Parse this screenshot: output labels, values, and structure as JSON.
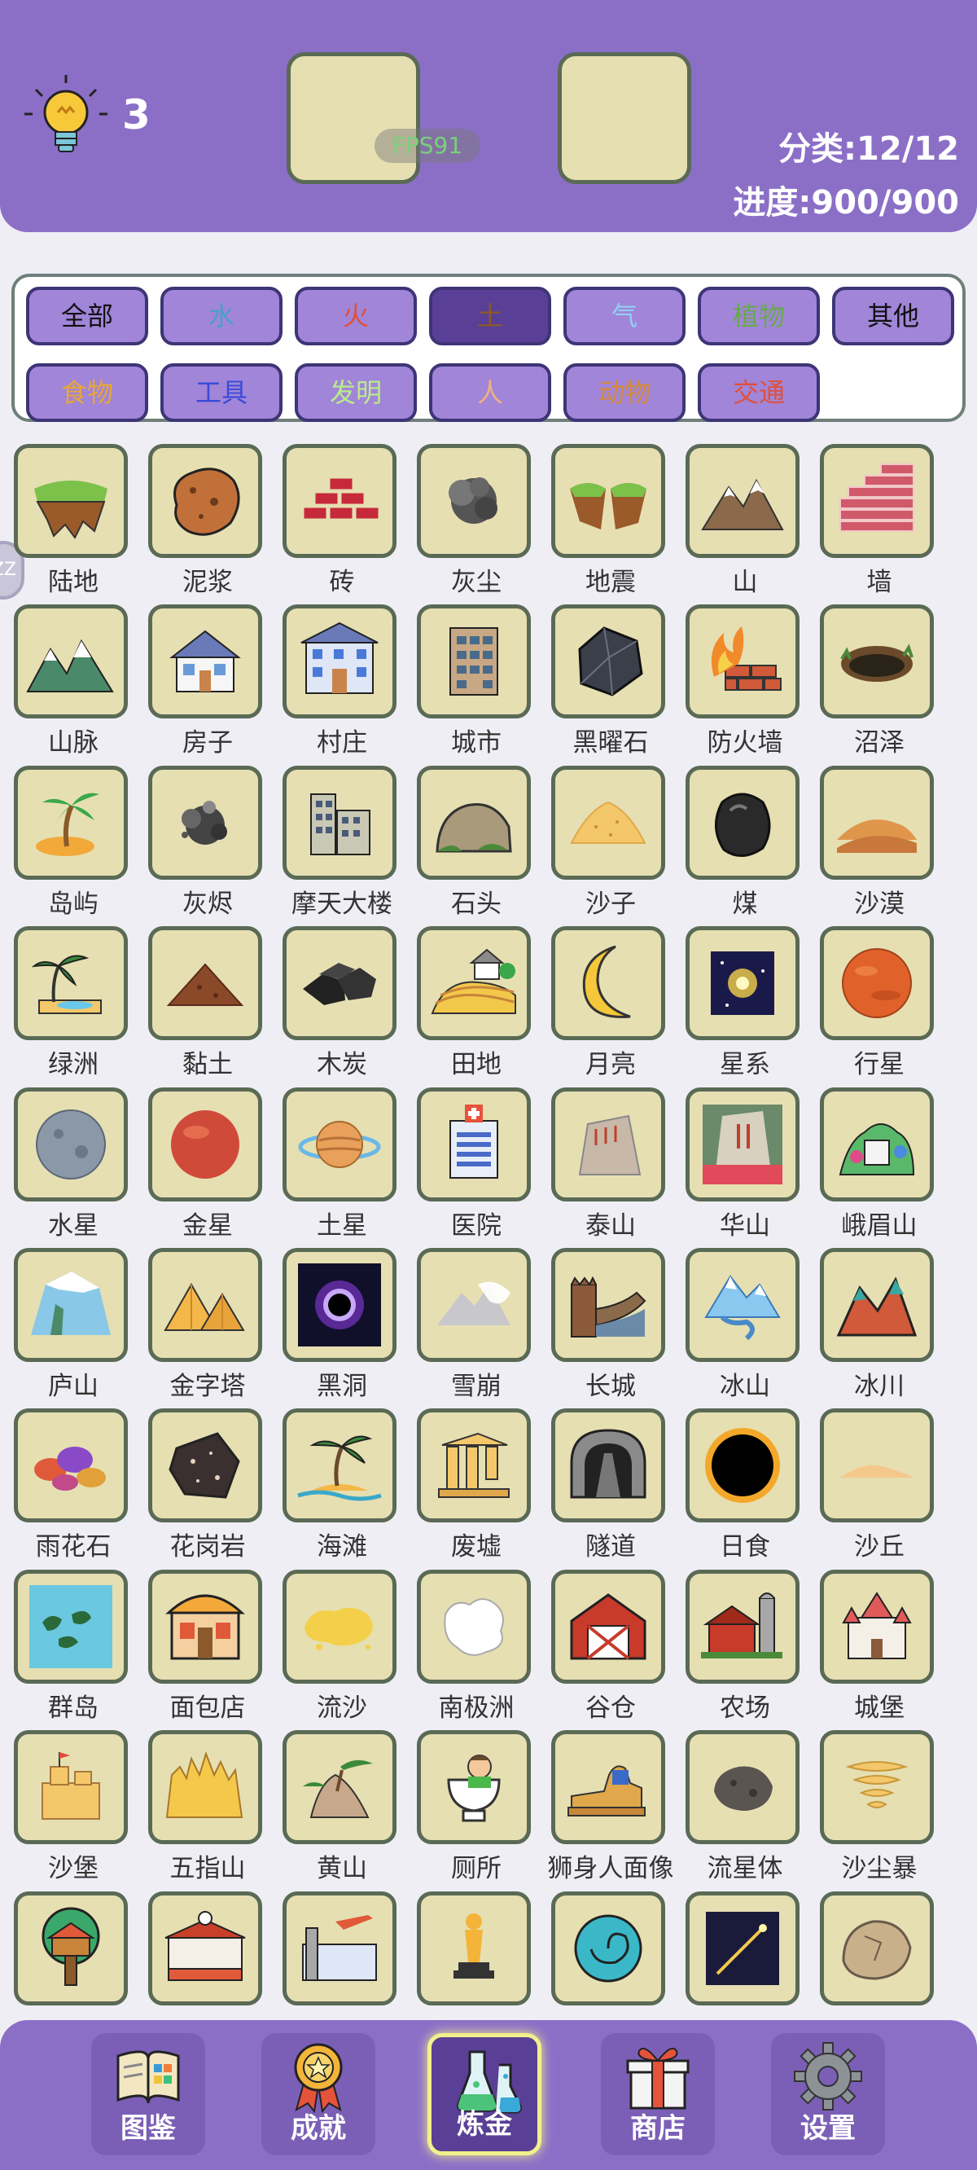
{
  "header": {
    "hint_count": "3",
    "fps": "FPS91",
    "category_stat": "分类:12/12",
    "progress_stat": "进度:900/900"
  },
  "categories": [
    {
      "label": "全部",
      "color": "#111111"
    },
    {
      "label": "水",
      "color": "#4aa0c8"
    },
    {
      "label": "火",
      "color": "#e0503a"
    },
    {
      "label": "土",
      "color": "#8a5a2a"
    },
    {
      "label": "气",
      "color": "#8fd0f0"
    },
    {
      "label": "植物",
      "color": "#6aa84f"
    },
    {
      "label": "其他",
      "color": "#111111"
    },
    {
      "label": "食物",
      "color": "#e8a63a"
    },
    {
      "label": "工具",
      "color": "#3a4ad8"
    },
    {
      "label": "发明",
      "color": "#b8ec8a"
    },
    {
      "label": "人",
      "color": "#f0b080"
    },
    {
      "label": "动物",
      "color": "#d68a3a"
    },
    {
      "label": "交通",
      "color": "#e0503a"
    }
  ],
  "active_category": "土",
  "elements": [
    {
      "label": "陆地",
      "icon": "land-icon"
    },
    {
      "label": "泥浆",
      "icon": "mud-icon"
    },
    {
      "label": "砖",
      "icon": "brick-icon"
    },
    {
      "label": "灰尘",
      "icon": "dust-icon"
    },
    {
      "label": "地震",
      "icon": "earthquake-icon"
    },
    {
      "label": "山",
      "icon": "mountain-icon"
    },
    {
      "label": "墙",
      "icon": "wall-icon"
    },
    {
      "label": "山脉",
      "icon": "mountain-range-icon"
    },
    {
      "label": "房子",
      "icon": "house-icon"
    },
    {
      "label": "村庄",
      "icon": "village-icon"
    },
    {
      "label": "城市",
      "icon": "city-icon"
    },
    {
      "label": "黑曜石",
      "icon": "obsidian-icon"
    },
    {
      "label": "防火墙",
      "icon": "firewall-icon"
    },
    {
      "label": "沼泽",
      "icon": "swamp-icon"
    },
    {
      "label": "岛屿",
      "icon": "island-icon"
    },
    {
      "label": "灰烬",
      "icon": "ash-icon"
    },
    {
      "label": "摩天大楼",
      "icon": "skyscraper-icon"
    },
    {
      "label": "石头",
      "icon": "stone-icon"
    },
    {
      "label": "沙子",
      "icon": "sand-icon"
    },
    {
      "label": "煤",
      "icon": "coal-icon"
    },
    {
      "label": "沙漠",
      "icon": "desert-icon"
    },
    {
      "label": "绿洲",
      "icon": "oasis-icon"
    },
    {
      "label": "黏土",
      "icon": "clay-icon"
    },
    {
      "label": "木炭",
      "icon": "charcoal-icon"
    },
    {
      "label": "田地",
      "icon": "field-icon"
    },
    {
      "label": "月亮",
      "icon": "moon-icon"
    },
    {
      "label": "星系",
      "icon": "galaxy-icon"
    },
    {
      "label": "行星",
      "icon": "planet-icon"
    },
    {
      "label": "水星",
      "icon": "mercury-icon"
    },
    {
      "label": "金星",
      "icon": "venus-icon"
    },
    {
      "label": "土星",
      "icon": "saturn-icon"
    },
    {
      "label": "医院",
      "icon": "hospital-icon"
    },
    {
      "label": "泰山",
      "icon": "mount-tai-icon"
    },
    {
      "label": "华山",
      "icon": "mount-hua-icon"
    },
    {
      "label": "峨眉山",
      "icon": "mount-emei-icon"
    },
    {
      "label": "庐山",
      "icon": "mount-lu-icon"
    },
    {
      "label": "金字塔",
      "icon": "pyramid-icon"
    },
    {
      "label": "黑洞",
      "icon": "black-hole-icon"
    },
    {
      "label": "雪崩",
      "icon": "avalanche-icon"
    },
    {
      "label": "长城",
      "icon": "great-wall-icon"
    },
    {
      "label": "冰山",
      "icon": "iceberg-icon"
    },
    {
      "label": "冰川",
      "icon": "glacier-icon"
    },
    {
      "label": "雨花石",
      "icon": "rain-flower-stone-icon"
    },
    {
      "label": "花岗岩",
      "icon": "granite-icon"
    },
    {
      "label": "海滩",
      "icon": "beach-icon"
    },
    {
      "label": "废墟",
      "icon": "ruins-icon"
    },
    {
      "label": "隧道",
      "icon": "tunnel-icon"
    },
    {
      "label": "日食",
      "icon": "eclipse-icon"
    },
    {
      "label": "沙丘",
      "icon": "dune-icon"
    },
    {
      "label": "群岛",
      "icon": "archipelago-icon"
    },
    {
      "label": "面包店",
      "icon": "bakery-icon"
    },
    {
      "label": "流沙",
      "icon": "quicksand-icon"
    },
    {
      "label": "南极洲",
      "icon": "antarctica-icon"
    },
    {
      "label": "谷仓",
      "icon": "barn-icon"
    },
    {
      "label": "农场",
      "icon": "farm-icon"
    },
    {
      "label": "城堡",
      "icon": "castle-icon"
    },
    {
      "label": "沙堡",
      "icon": "sandcastle-icon"
    },
    {
      "label": "五指山",
      "icon": "five-finger-mountain-icon"
    },
    {
      "label": "黄山",
      "icon": "mount-huang-icon"
    },
    {
      "label": "厕所",
      "icon": "toilet-icon"
    },
    {
      "label": "狮身人面像",
      "icon": "sphinx-icon"
    },
    {
      "label": "流星体",
      "icon": "meteoroid-icon"
    },
    {
      "label": "沙尘暴",
      "icon": "sandstorm-icon"
    },
    {
      "label": "",
      "icon": "treehouse-icon"
    },
    {
      "label": "",
      "icon": "train-station-icon"
    },
    {
      "label": "",
      "icon": "airport-icon"
    },
    {
      "label": "",
      "icon": "statue-icon"
    },
    {
      "label": "",
      "icon": "fossil-icon"
    },
    {
      "label": "",
      "icon": "meteor-icon"
    },
    {
      "label": "",
      "icon": "boulder-icon"
    }
  ],
  "nav": [
    {
      "label": "图鉴",
      "icon": "encyclopedia-icon"
    },
    {
      "label": "成就",
      "icon": "achievement-medal-icon"
    },
    {
      "label": "炼金",
      "icon": "alchemy-flask-icon"
    },
    {
      "label": "商店",
      "icon": "shop-gift-icon"
    },
    {
      "label": "设置",
      "icon": "settings-gear-icon"
    }
  ],
  "active_nav": "炼金",
  "side_handle": "ZZ"
}
